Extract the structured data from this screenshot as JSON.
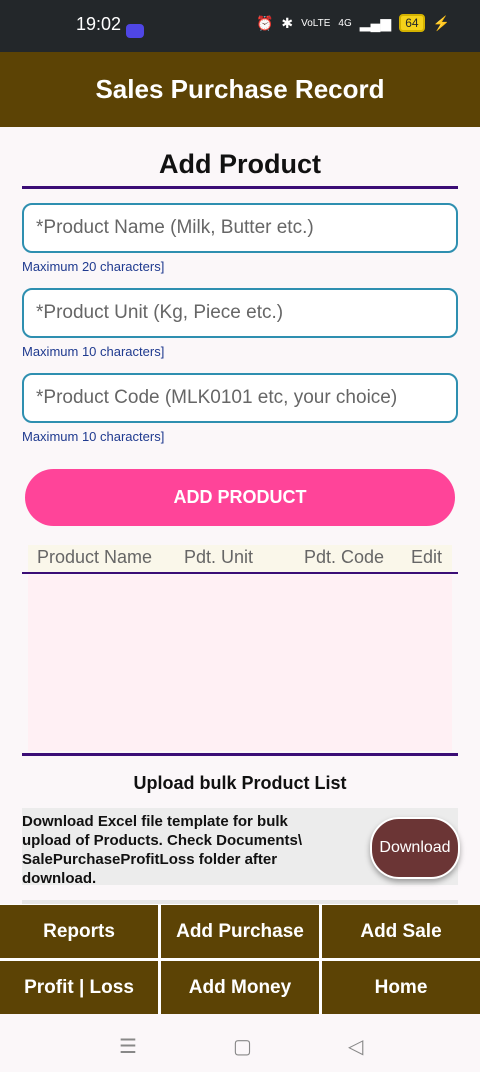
{
  "status_bar": {
    "time": "19:02",
    "battery": "64",
    "network": "4G",
    "volte": "VoLTE"
  },
  "app_bar": {
    "title": "Sales Purchase Record"
  },
  "form": {
    "title": "Add Product",
    "fields": [
      {
        "placeholder": "*Product Name (Milk, Butter etc.)",
        "hint": "Maximum 20 characters]"
      },
      {
        "placeholder": "*Product Unit (Kg, Piece etc.)",
        "hint": "Maximum 10 characters]"
      },
      {
        "placeholder": "*Product Code (MLK0101 etc, your choice)",
        "hint": "Maximum 10 characters]"
      }
    ],
    "add_button": "ADD PRODUCT"
  },
  "table": {
    "columns": [
      "Product Name",
      "Pdt. Unit",
      "Pdt. Code",
      "Edit"
    ],
    "rows": []
  },
  "upload": {
    "title": "Upload bulk Product List",
    "description": "Download Excel file template for bulk upload of Products. Check Documents\\ SalePurchaseProfitLoss folder after download.",
    "download_button": "Download"
  },
  "bottom_nav": [
    {
      "label": "Reports"
    },
    {
      "label": "Add Purchase"
    },
    {
      "label": "Add Sale"
    },
    {
      "label": "Profit | Loss"
    },
    {
      "label": "Add Money"
    },
    {
      "label": "Home"
    }
  ],
  "system_nav": {
    "menu_icon": "menu-icon",
    "home_icon": "home-square-icon",
    "back_icon": "back-triangle-icon"
  },
  "colors": {
    "brand": "#5c4305",
    "accent": "#ff4499",
    "divider": "#3b0d76",
    "field_border": "#2e8fb0",
    "download": "#6b3535"
  }
}
